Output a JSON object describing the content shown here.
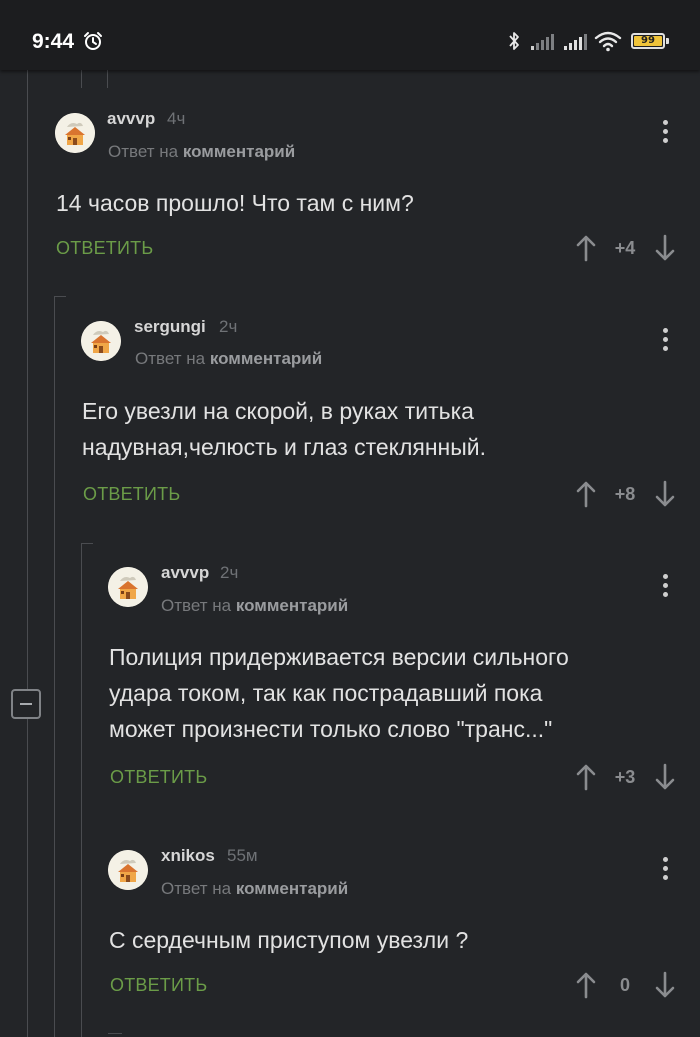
{
  "status_bar": {
    "time": "9:44",
    "battery": "99"
  },
  "labels": {
    "reply_to_prefix": "Ответ на",
    "reply_to_target": "комментарий",
    "reply_button": "ОТВЕТИТЬ"
  },
  "comments": [
    {
      "author": "avvvp",
      "time": "4ч",
      "lines": [
        "14 часов прошло! Что там с ним?"
      ],
      "rating": "+4"
    },
    {
      "author": "sergungi",
      "time": "2ч",
      "lines": [
        "Его увезли на скорой, в руках титька",
        "надувная,челюсть и глаз стеклянный."
      ],
      "rating": "+8"
    },
    {
      "author": "avvvp",
      "time": "2ч",
      "lines": [
        "Полиция придерживается версии сильного",
        "удара током, так как пострадавший пока",
        "может произнести только слово \"транс...\""
      ],
      "rating": "+3"
    },
    {
      "author": "xnikos",
      "time": "55м",
      "lines": [
        "С сердечным приступом увезли ?"
      ],
      "rating": "0"
    }
  ],
  "colors": {
    "background": "#232528",
    "reply_button": "#6b9c48",
    "battery": "#f0c43a"
  }
}
